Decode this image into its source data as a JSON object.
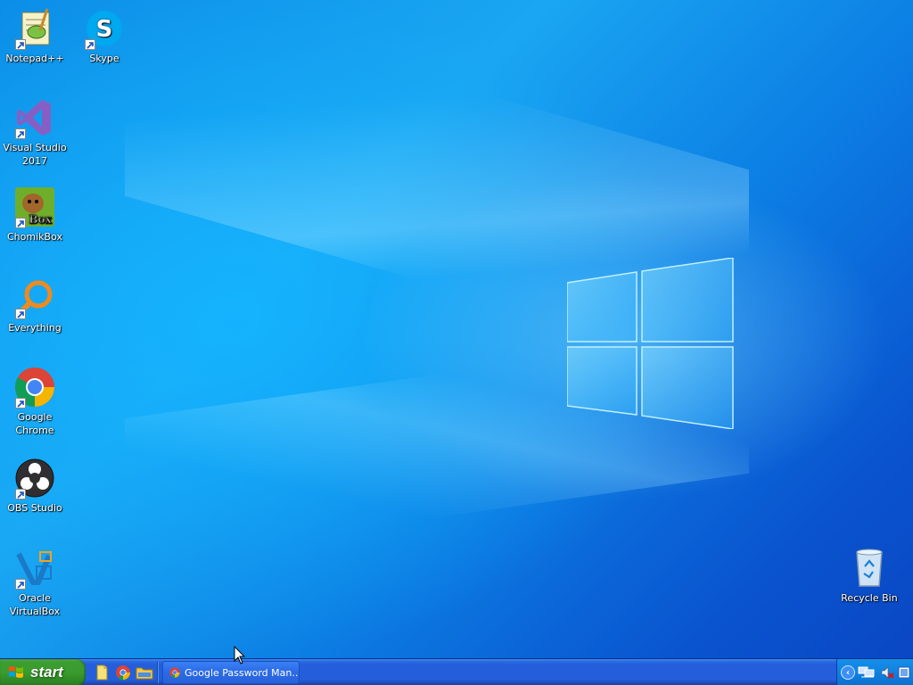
{
  "desktop": {
    "icons": [
      {
        "id": "notepadpp",
        "label": "Notepad++"
      },
      {
        "id": "skype",
        "label": "Skype"
      },
      {
        "id": "visual-studio",
        "label": "Visual Studio 2017"
      },
      {
        "id": "chomikbox",
        "label": "ChomikBox"
      },
      {
        "id": "everything",
        "label": "Everything"
      },
      {
        "id": "google-chrome",
        "label": "Google Chrome"
      },
      {
        "id": "obs-studio",
        "label": "OBS Studio"
      },
      {
        "id": "oracle-virtualbox",
        "label": "Oracle VirtualBox"
      },
      {
        "id": "recycle-bin",
        "label": "Recycle Bin"
      }
    ]
  },
  "taskbar": {
    "start_label": "start",
    "quick_launch": [
      "show-desktop-icon",
      "chrome-icon",
      "file-explorer-icon"
    ],
    "tasks": [
      {
        "label": "Google Password Man...",
        "icon": "chrome-icon"
      }
    ],
    "tray_icons": [
      "tray-chevron-icon",
      "network-icon",
      "volume-muted-icon",
      "tray-app-icon"
    ]
  },
  "colors": {
    "taskbar": "#245edb",
    "start_button": "#3a9b2f",
    "tray": "#0f81e0",
    "desktop_accent": "#1aa6f2"
  }
}
